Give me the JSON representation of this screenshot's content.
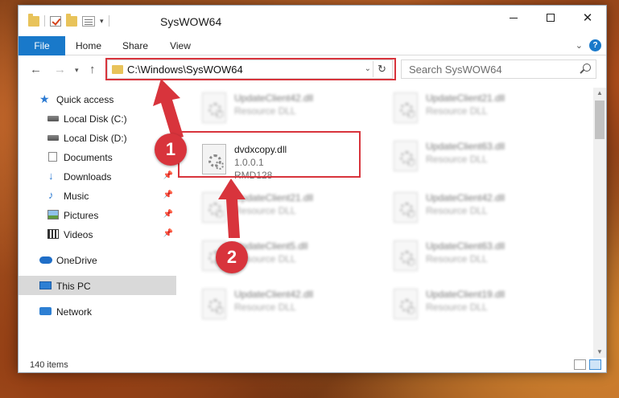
{
  "window": {
    "title": "SysWOW64",
    "controls": {
      "minimize": "minimize",
      "maximize": "maximize",
      "close": "✕"
    }
  },
  "ribbon": {
    "tabs": [
      "File",
      "Home",
      "Share",
      "View"
    ],
    "help": "?"
  },
  "nav": {
    "address": "C:\\Windows\\SysWOW64",
    "search_placeholder": "Search SysWOW64"
  },
  "sidebar": {
    "items": [
      {
        "label": "Quick access",
        "icon": "star-icon",
        "pinned": false
      },
      {
        "label": "Local Disk (C:)",
        "icon": "drive-icon",
        "pinned": false
      },
      {
        "label": "Local Disk (D:)",
        "icon": "drive-icon",
        "pinned": false
      },
      {
        "label": "Documents",
        "icon": "documents-icon",
        "pinned": true
      },
      {
        "label": "Downloads",
        "icon": "downloads-icon",
        "pinned": true
      },
      {
        "label": "Music",
        "icon": "music-icon",
        "pinned": true
      },
      {
        "label": "Pictures",
        "icon": "pictures-icon",
        "pinned": true
      },
      {
        "label": "Videos",
        "icon": "videos-icon",
        "pinned": true
      },
      {
        "label": "OneDrive",
        "icon": "onedrive-icon",
        "pinned": false
      },
      {
        "label": "This PC",
        "icon": "pc-icon",
        "pinned": false,
        "selected": true
      },
      {
        "label": "Network",
        "icon": "network-icon",
        "pinned": false
      }
    ]
  },
  "files": {
    "left_column": [
      {
        "name": "UpdateClient42.dll",
        "desc": "Resource DLL",
        "blurred": true
      },
      {
        "name": "dvdxcopy.dll",
        "desc": "1.0.0.1",
        "extra": "RMD128",
        "blurred": false,
        "highlighted": true
      },
      {
        "name": "UpdateClient21.dll",
        "desc": "Resource DLL",
        "blurred": true
      },
      {
        "name": "UpdateClient5.dll",
        "desc": "Resource DLL",
        "blurred": true
      },
      {
        "name": "UpdateClient42.dll",
        "desc": "Resource DLL",
        "blurred": true
      }
    ],
    "right_column": [
      {
        "name": "UpdateClient21.dll",
        "desc": "Resource DLL",
        "blurred": true
      },
      {
        "name": "UpdateClient63.dll",
        "desc": "Resource DLL",
        "blurred": true
      },
      {
        "name": "UpdateClient42.dll",
        "desc": "Resource DLL",
        "blurred": true
      },
      {
        "name": "UpdateClient63.dll",
        "desc": "Resource DLL",
        "blurred": true
      },
      {
        "name": "UpdateClient19.dll",
        "desc": "Resource DLL",
        "blurred": true
      }
    ]
  },
  "status": {
    "item_count": "140 items"
  },
  "annotations": {
    "step1": "1",
    "step2": "2",
    "highlight_color": "#d8343c"
  }
}
